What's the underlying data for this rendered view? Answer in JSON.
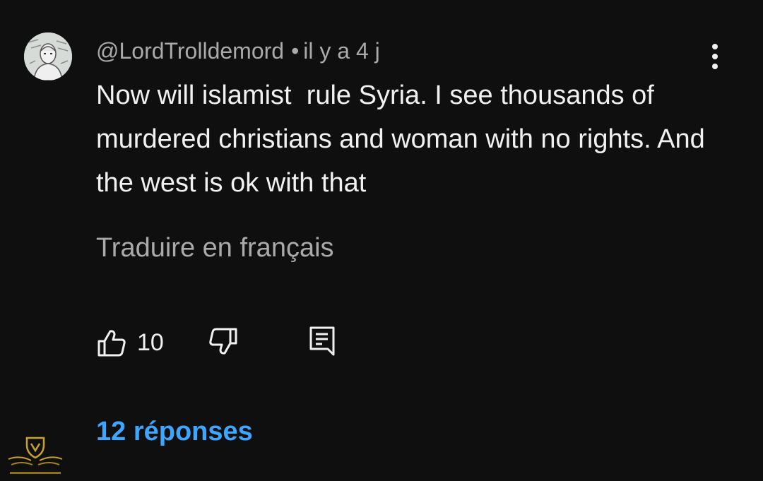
{
  "comment": {
    "author": "@LordTrolldemord",
    "separator": "•",
    "time": "il y a 4 j",
    "text": "Now will islamist  rule Syria. I see thousands of murdered christians and woman with no rights. And the west is ok with that",
    "translate_label": "Traduire en français",
    "like_count": "10",
    "replies_label": "12 réponses"
  },
  "icons": {
    "more": "more-vertical-icon",
    "like": "thumbs-up-icon",
    "dislike": "thumbs-down-icon",
    "reply": "comment-reply-icon"
  },
  "colors": {
    "background": "#0f0f0f",
    "primary_text": "#f1f1f1",
    "secondary_text": "#aaaaaa",
    "link": "#3ea6ff"
  }
}
